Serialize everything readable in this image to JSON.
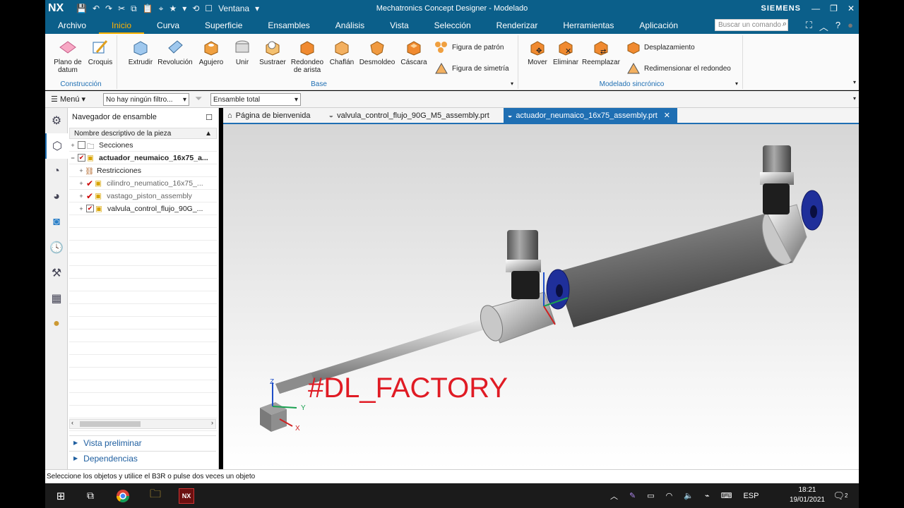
{
  "titlebar": {
    "logo": "NX",
    "window_menu": "Ventana",
    "title": "Mechatronics Concept Designer - Modelado",
    "brand": "SIEMENS"
  },
  "menu_tabs": [
    "Archivo",
    "Inicio",
    "Curva",
    "Superficie",
    "Ensambles",
    "Análisis",
    "Vista",
    "Selección",
    "Renderizar",
    "Herramientas",
    "Aplicación"
  ],
  "active_tab": "Inicio",
  "search": {
    "placeholder": "Buscar un comando"
  },
  "ribbon": {
    "construccion": {
      "label": "Construcción",
      "plano": "Plano de datum",
      "croquis": "Croquis"
    },
    "base": {
      "label": "Base",
      "buttons": [
        "Extrudir",
        "Revolución",
        "Agujero",
        "Unir",
        "Sustraer",
        "Redondeo de arista",
        "Chaflán",
        "Desmoldeo",
        "Cáscara"
      ],
      "patron": "Figura de patrón",
      "simetria": "Figura de simetría"
    },
    "sincronico": {
      "label": "Modelado sincrónico",
      "buttons": [
        "Mover",
        "Eliminar",
        "Reemplazar"
      ],
      "desplazamiento": "Desplazamiento",
      "redimensionar": "Redimensionar el redondeo"
    }
  },
  "toolbar": {
    "menu": "Menú",
    "filter": "No hay ningún filtro...",
    "scope": "Ensamble total"
  },
  "navigator": {
    "title": "Navegador de ensamble",
    "column": "Nombre descriptivo de la pieza",
    "rows": [
      "Secciones",
      "actuador_neumaico_16x75_a...",
      "Restricciones",
      "cilindro_neumatico_16x75_...",
      "vastago_piston_assembly",
      "valvula_control_flujo_90G_..."
    ],
    "vista": "Vista preliminar",
    "dependencias": "Dependencias"
  },
  "doc_tabs": [
    "Página de bienvenida",
    "valvula_control_flujo_90G_M5_assembly.prt",
    "actuador_neumaico_16x75_assembly.prt"
  ],
  "watermark": "#DL_FACTORY",
  "triad": {
    "z": "Z",
    "y": "Y",
    "x": "X"
  },
  "status": "Seleccione los objetos y utilice el B3R o pulse dos veces un objeto",
  "taskbar": {
    "lang": "ESP",
    "time": "18:21",
    "date": "19/01/2021",
    "notif": "2",
    "nx_label": "NX"
  },
  "colors": {
    "accent": "#0b5f8a",
    "highlight": "#ffb000",
    "blue_fitting": "#1f2f9a",
    "watermark": "#e01b24"
  }
}
